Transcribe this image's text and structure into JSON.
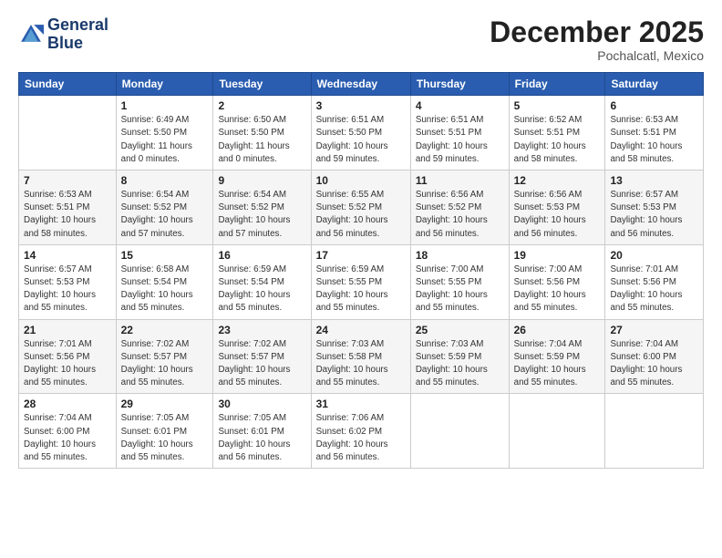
{
  "logo": {
    "line1": "General",
    "line2": "Blue"
  },
  "title": "December 2025",
  "location": "Pochalcatl, Mexico",
  "days_header": [
    "Sunday",
    "Monday",
    "Tuesday",
    "Wednesday",
    "Thursday",
    "Friday",
    "Saturday"
  ],
  "weeks": [
    [
      {
        "num": "",
        "info": ""
      },
      {
        "num": "1",
        "info": "Sunrise: 6:49 AM\nSunset: 5:50 PM\nDaylight: 11 hours\nand 0 minutes."
      },
      {
        "num": "2",
        "info": "Sunrise: 6:50 AM\nSunset: 5:50 PM\nDaylight: 11 hours\nand 0 minutes."
      },
      {
        "num": "3",
        "info": "Sunrise: 6:51 AM\nSunset: 5:50 PM\nDaylight: 10 hours\nand 59 minutes."
      },
      {
        "num": "4",
        "info": "Sunrise: 6:51 AM\nSunset: 5:51 PM\nDaylight: 10 hours\nand 59 minutes."
      },
      {
        "num": "5",
        "info": "Sunrise: 6:52 AM\nSunset: 5:51 PM\nDaylight: 10 hours\nand 58 minutes."
      },
      {
        "num": "6",
        "info": "Sunrise: 6:53 AM\nSunset: 5:51 PM\nDaylight: 10 hours\nand 58 minutes."
      }
    ],
    [
      {
        "num": "7",
        "info": "Sunrise: 6:53 AM\nSunset: 5:51 PM\nDaylight: 10 hours\nand 58 minutes."
      },
      {
        "num": "8",
        "info": "Sunrise: 6:54 AM\nSunset: 5:52 PM\nDaylight: 10 hours\nand 57 minutes."
      },
      {
        "num": "9",
        "info": "Sunrise: 6:54 AM\nSunset: 5:52 PM\nDaylight: 10 hours\nand 57 minutes."
      },
      {
        "num": "10",
        "info": "Sunrise: 6:55 AM\nSunset: 5:52 PM\nDaylight: 10 hours\nand 56 minutes."
      },
      {
        "num": "11",
        "info": "Sunrise: 6:56 AM\nSunset: 5:52 PM\nDaylight: 10 hours\nand 56 minutes."
      },
      {
        "num": "12",
        "info": "Sunrise: 6:56 AM\nSunset: 5:53 PM\nDaylight: 10 hours\nand 56 minutes."
      },
      {
        "num": "13",
        "info": "Sunrise: 6:57 AM\nSunset: 5:53 PM\nDaylight: 10 hours\nand 56 minutes."
      }
    ],
    [
      {
        "num": "14",
        "info": "Sunrise: 6:57 AM\nSunset: 5:53 PM\nDaylight: 10 hours\nand 55 minutes."
      },
      {
        "num": "15",
        "info": "Sunrise: 6:58 AM\nSunset: 5:54 PM\nDaylight: 10 hours\nand 55 minutes."
      },
      {
        "num": "16",
        "info": "Sunrise: 6:59 AM\nSunset: 5:54 PM\nDaylight: 10 hours\nand 55 minutes."
      },
      {
        "num": "17",
        "info": "Sunrise: 6:59 AM\nSunset: 5:55 PM\nDaylight: 10 hours\nand 55 minutes."
      },
      {
        "num": "18",
        "info": "Sunrise: 7:00 AM\nSunset: 5:55 PM\nDaylight: 10 hours\nand 55 minutes."
      },
      {
        "num": "19",
        "info": "Sunrise: 7:00 AM\nSunset: 5:56 PM\nDaylight: 10 hours\nand 55 minutes."
      },
      {
        "num": "20",
        "info": "Sunrise: 7:01 AM\nSunset: 5:56 PM\nDaylight: 10 hours\nand 55 minutes."
      }
    ],
    [
      {
        "num": "21",
        "info": "Sunrise: 7:01 AM\nSunset: 5:56 PM\nDaylight: 10 hours\nand 55 minutes."
      },
      {
        "num": "22",
        "info": "Sunrise: 7:02 AM\nSunset: 5:57 PM\nDaylight: 10 hours\nand 55 minutes."
      },
      {
        "num": "23",
        "info": "Sunrise: 7:02 AM\nSunset: 5:57 PM\nDaylight: 10 hours\nand 55 minutes."
      },
      {
        "num": "24",
        "info": "Sunrise: 7:03 AM\nSunset: 5:58 PM\nDaylight: 10 hours\nand 55 minutes."
      },
      {
        "num": "25",
        "info": "Sunrise: 7:03 AM\nSunset: 5:59 PM\nDaylight: 10 hours\nand 55 minutes."
      },
      {
        "num": "26",
        "info": "Sunrise: 7:04 AM\nSunset: 5:59 PM\nDaylight: 10 hours\nand 55 minutes."
      },
      {
        "num": "27",
        "info": "Sunrise: 7:04 AM\nSunset: 6:00 PM\nDaylight: 10 hours\nand 55 minutes."
      }
    ],
    [
      {
        "num": "28",
        "info": "Sunrise: 7:04 AM\nSunset: 6:00 PM\nDaylight: 10 hours\nand 55 minutes."
      },
      {
        "num": "29",
        "info": "Sunrise: 7:05 AM\nSunset: 6:01 PM\nDaylight: 10 hours\nand 55 minutes."
      },
      {
        "num": "30",
        "info": "Sunrise: 7:05 AM\nSunset: 6:01 PM\nDaylight: 10 hours\nand 56 minutes."
      },
      {
        "num": "31",
        "info": "Sunrise: 7:06 AM\nSunset: 6:02 PM\nDaylight: 10 hours\nand 56 minutes."
      },
      {
        "num": "",
        "info": ""
      },
      {
        "num": "",
        "info": ""
      },
      {
        "num": "",
        "info": ""
      }
    ]
  ]
}
